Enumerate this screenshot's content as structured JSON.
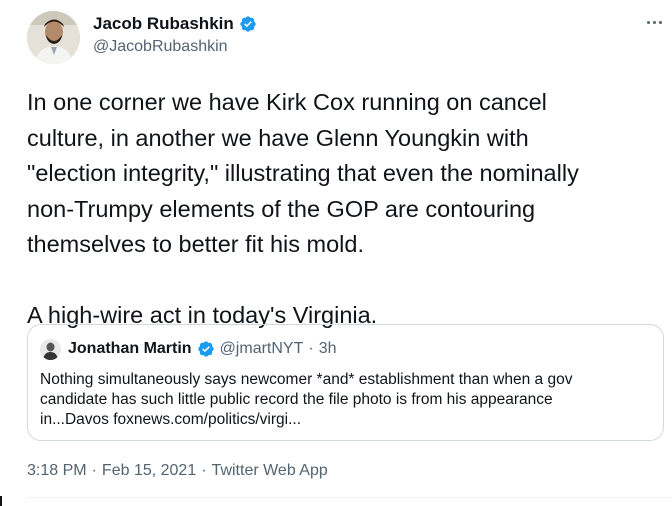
{
  "author": {
    "name": "Jacob Rubashkin",
    "handle": "@JacobRubashkin",
    "verified": true
  },
  "tweet": {
    "lines": [
      "In one corner we have Kirk Cox running on cancel",
      "culture, in another we have Glenn Youngkin with",
      "\"election integrity,\" illustrating that even the nominally",
      "non-Trumpy elements of the GOP are contouring",
      "themselves to better fit his mold."
    ],
    "closing": "A high-wire act in today's Virginia."
  },
  "quoted": {
    "name": "Jonathan Martin",
    "handle": "@jmartNYT",
    "separator": "·",
    "time": "3h",
    "lines": [
      "Nothing simultaneously says newcomer *and* establishment than when a gov",
      "candidate has such little public record the file photo is from his appearance",
      "in...Davos  foxnews.com/politics/virgi..."
    ]
  },
  "meta": {
    "time": "3:18 PM",
    "separator1": "·",
    "date": "Feb 15, 2021",
    "separator2": "·",
    "source": "Twitter Web App"
  },
  "icons": {
    "verified": "verified-badge-icon",
    "more": "more-options-icon"
  },
  "colors": {
    "text": "#0f1419",
    "secondary": "#536471",
    "verified": "#1d9bf0",
    "border": "#cfd9de"
  }
}
